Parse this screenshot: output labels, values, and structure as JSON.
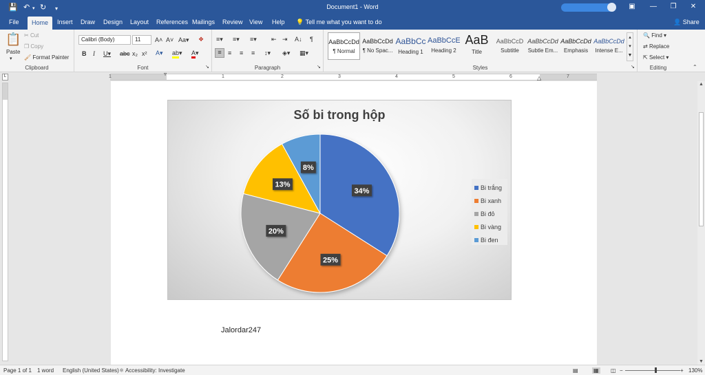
{
  "window": {
    "title": "Document1  -  Word"
  },
  "tabs": [
    {
      "label": "File"
    },
    {
      "label": "Home"
    },
    {
      "label": "Insert"
    },
    {
      "label": "Draw"
    },
    {
      "label": "Design"
    },
    {
      "label": "Layout"
    },
    {
      "label": "References"
    },
    {
      "label": "Mailings"
    },
    {
      "label": "Review"
    },
    {
      "label": "View"
    },
    {
      "label": "Help"
    }
  ],
  "tell_me": "Tell me what you want to do",
  "share": "Share",
  "clipboard": {
    "paste": "Paste",
    "cut": "Cut",
    "copy": "Copy",
    "format_painter": "Format Painter",
    "label": "Clipboard"
  },
  "font": {
    "family": "Calibri (Body)",
    "size": "11",
    "label": "Font"
  },
  "paragraph": {
    "label": "Paragraph"
  },
  "styles": {
    "label": "Styles",
    "items": [
      {
        "preview": "AaBbCcDd",
        "name": "¶ Normal"
      },
      {
        "preview": "AaBbCcDd",
        "name": "¶ No Spac..."
      },
      {
        "preview": "AaBbCc",
        "name": "Heading 1"
      },
      {
        "preview": "AaBbCcE",
        "name": "Heading 2"
      },
      {
        "preview": "AaB",
        "name": "Title"
      },
      {
        "preview": "AaBbCcD",
        "name": "Subtitle"
      },
      {
        "preview": "AaBbCcDd",
        "name": "Subtle Em..."
      },
      {
        "preview": "AaBbCcDd",
        "name": "Emphasis"
      },
      {
        "preview": "AaBbCcDd",
        "name": "Intense E..."
      }
    ]
  },
  "editing": {
    "find": "Find",
    "replace": "Replace",
    "select": "Select",
    "label": "Editing"
  },
  "ruler": {
    "numbers": [
      "1",
      "1",
      "2",
      "3",
      "4",
      "5",
      "6",
      "7"
    ]
  },
  "document": {
    "author_text": "Jalordar247"
  },
  "chart_data": {
    "type": "pie",
    "title": "Số bi trong hộp",
    "categories": [
      "Bi trắng",
      "Bi xanh",
      "Bi đỏ",
      "Bi vàng",
      "Bi đen"
    ],
    "values": [
      34,
      25,
      20,
      13,
      8
    ],
    "data_labels": [
      "34%",
      "25%",
      "20%",
      "13%",
      "8%"
    ],
    "colors": [
      "#4472c4",
      "#ed7d31",
      "#a5a5a5",
      "#ffc000",
      "#5b9bd5"
    ],
    "legend_position": "right"
  },
  "status": {
    "page": "Page 1 of 1",
    "words": "1 word",
    "language": "English (United States)",
    "accessibility": "Accessibility: Investigate",
    "zoom": "130%"
  },
  "icons": {
    "accent": "#2b579a"
  }
}
